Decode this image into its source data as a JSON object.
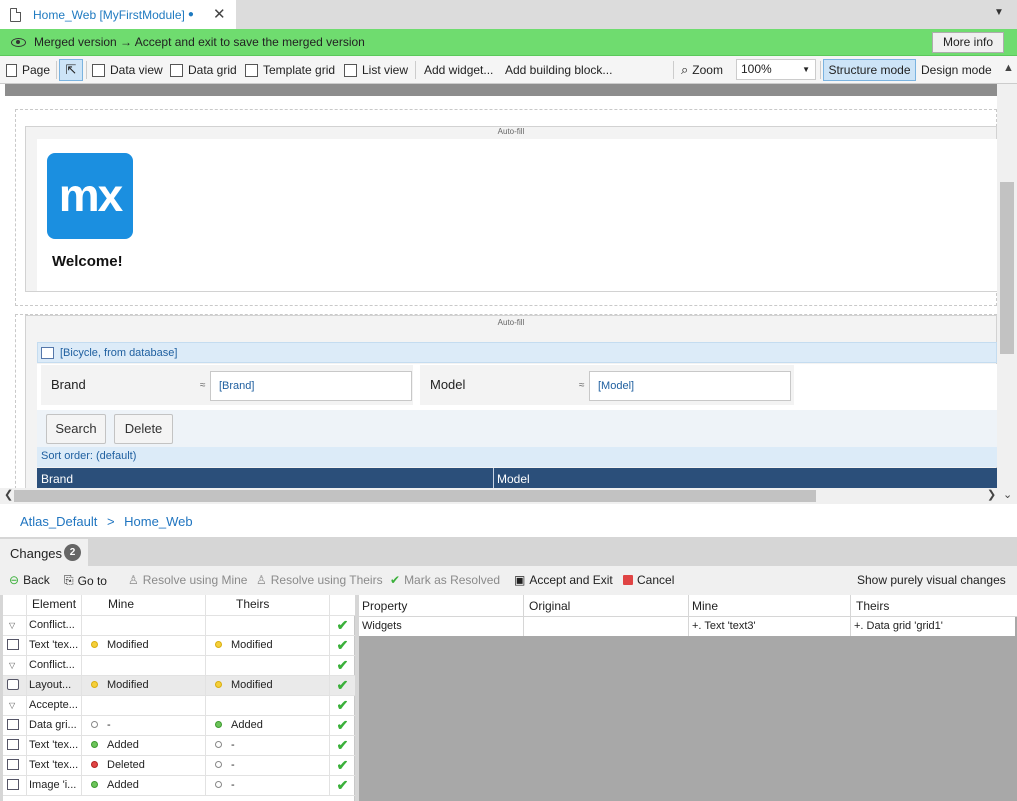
{
  "tab": {
    "title": "Home_Web [MyFirstModule]",
    "modified_dot": "●"
  },
  "banner": {
    "text": "Merged version → Accept and exit to save the merged version",
    "more_info": "More info"
  },
  "toolbar": {
    "page": "Page",
    "data_view": "Data view",
    "data_grid": "Data grid",
    "template_grid": "Template grid",
    "list_view": "List view",
    "add_widget": "Add widget...",
    "add_building_block": "Add building block...",
    "zoom_label": "Zoom",
    "zoom_value": "100%",
    "structure_mode": "Structure mode",
    "design_mode": "Design mode"
  },
  "canvas": {
    "autofill_1": "Auto-fill",
    "autofill_2": "Auto-fill",
    "logo_text": "mx",
    "welcome": "Welcome!",
    "data_grid_source": "[Bicycle, from database]",
    "search_fields": [
      {
        "label": "Brand",
        "approx": "≈",
        "value": "[Brand]"
      },
      {
        "label": "Model",
        "approx": "≈",
        "value": "[Model]"
      }
    ],
    "search_button": "Search",
    "delete_button": "Delete",
    "sort_order": "Sort order: (default)",
    "columns": [
      "Brand",
      "Model"
    ]
  },
  "breadcrumb": {
    "items": [
      "Atlas_Default",
      ">",
      "Home_Web"
    ]
  },
  "changes": {
    "tab_label": "Changes",
    "badge": "2",
    "toolbar": {
      "back": "Back",
      "go_to": "Go to",
      "resolve_mine": "Resolve using Mine",
      "resolve_theirs": "Resolve using Theirs",
      "mark_resolved": "Mark as Resolved",
      "accept_exit": "Accept and Exit",
      "cancel": "Cancel",
      "show_visual": "Show purely visual changes"
    },
    "left_headers": {
      "element": "Element",
      "mine": "Mine",
      "theirs": "Theirs"
    },
    "rows": [
      {
        "element": "Conflict...",
        "mine": "",
        "theirs": "",
        "mine_status": "",
        "theirs_status": ""
      },
      {
        "element": "Text 'tex...",
        "mine": "Modified",
        "theirs": "Modified",
        "mine_status": "modified",
        "theirs_status": "modified"
      },
      {
        "element": "Conflict...",
        "mine": "",
        "theirs": "",
        "mine_status": "",
        "theirs_status": ""
      },
      {
        "element": "Layout...",
        "mine": "Modified",
        "theirs": "Modified",
        "mine_status": "modified",
        "theirs_status": "modified"
      },
      {
        "element": "Accepte...",
        "mine": "",
        "theirs": "",
        "mine_status": "",
        "theirs_status": ""
      },
      {
        "element": "Data gri...",
        "mine": "-",
        "theirs": "Added",
        "mine_status": "none",
        "theirs_status": "added"
      },
      {
        "element": "Text 'tex...",
        "mine": "Added",
        "theirs": "-",
        "mine_status": "added",
        "theirs_status": "none"
      },
      {
        "element": "Text 'tex...",
        "mine": "Deleted",
        "theirs": "-",
        "mine_status": "deleted",
        "theirs_status": "none"
      },
      {
        "element": "Image 'i...",
        "mine": "Added",
        "theirs": "-",
        "mine_status": "added",
        "theirs_status": "none"
      }
    ],
    "right_headers": {
      "property": "Property",
      "original": "Original",
      "mine": "Mine",
      "theirs": "Theirs"
    },
    "detail": {
      "property": "Widgets",
      "original": "",
      "mine": "+. Text 'text3'",
      "theirs": "+. Data grid 'grid1'"
    }
  },
  "colors": {
    "banner": "#6fdc6f",
    "accent": "#1f7ac0",
    "logo": "#1b8fe0",
    "grid_header": "#2b4f7a"
  }
}
